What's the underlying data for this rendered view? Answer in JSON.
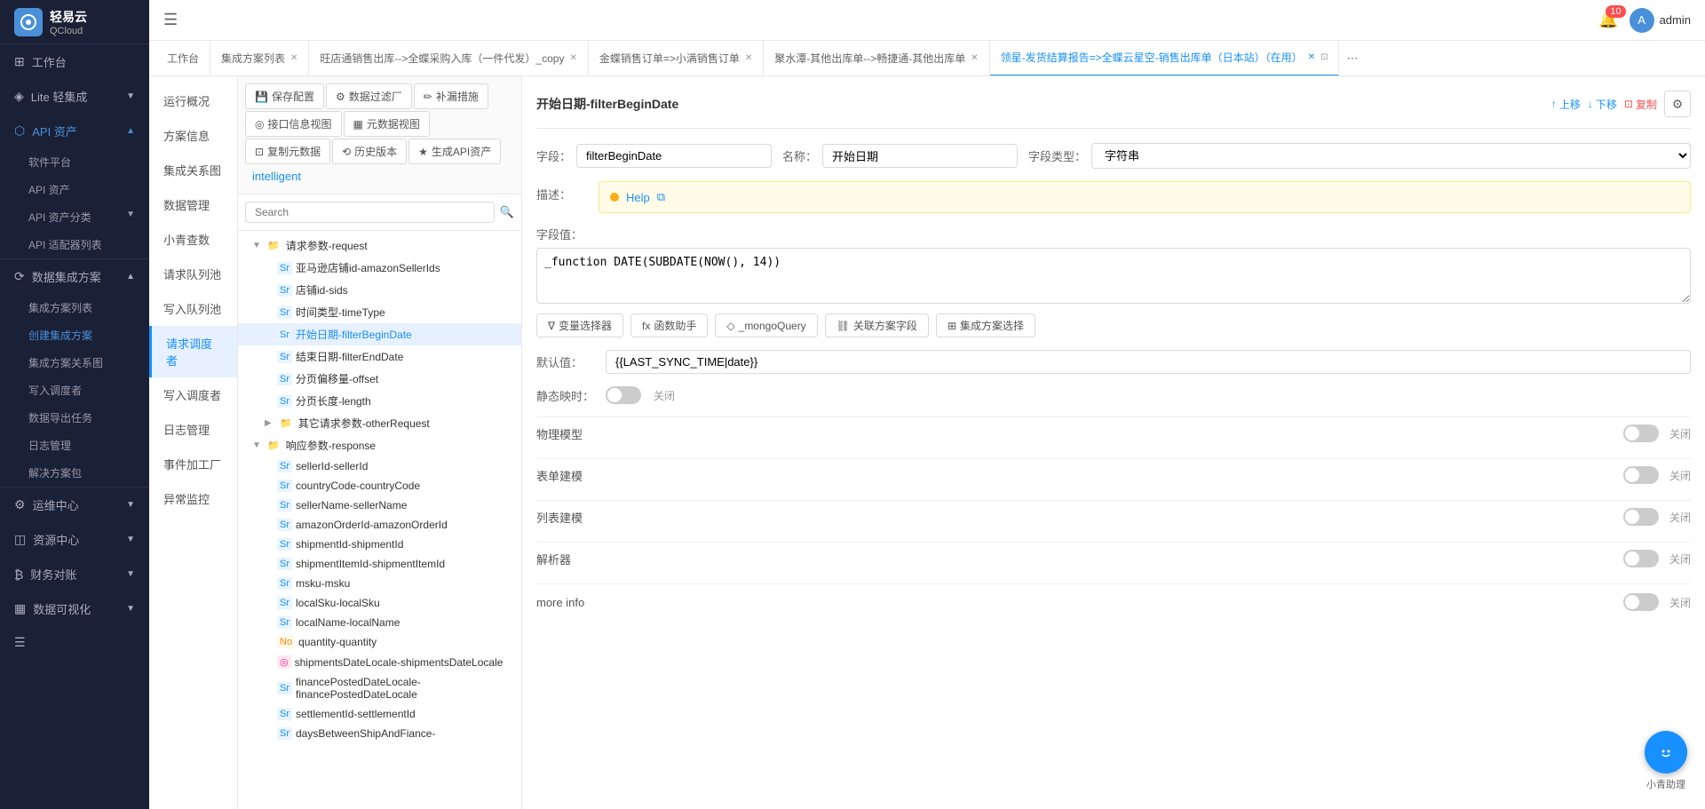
{
  "sidebar": {
    "logo_text": "轻易云",
    "logo_sub": "QCloud",
    "items": [
      {
        "id": "workspace",
        "label": "工作台",
        "icon": "⊞",
        "has_arrow": false
      },
      {
        "id": "lite",
        "label": "Lite 轻集成",
        "icon": "◈",
        "has_arrow": true
      },
      {
        "id": "api_assets",
        "label": "API 资产",
        "icon": "⬡",
        "has_arrow": true,
        "active": true,
        "expanded": true
      },
      {
        "id": "software_platform",
        "label": "软件平台",
        "sub": true
      },
      {
        "id": "api_assets_sub",
        "label": "API 资产",
        "sub": true
      },
      {
        "id": "api_category",
        "label": "API 资产分类",
        "sub": true,
        "has_arrow": true
      },
      {
        "id": "api_adapter",
        "label": "API 适配器列表",
        "sub": true
      },
      {
        "id": "data_integration",
        "label": "数据集成方案",
        "icon": "⟳",
        "has_arrow": true,
        "expanded": true
      },
      {
        "id": "integration_list",
        "label": "集成方案列表",
        "sub": true
      },
      {
        "id": "create_integration",
        "label": "创建集成方案",
        "sub": true,
        "active": true
      },
      {
        "id": "integration_rel",
        "label": "集成方案关系图",
        "sub": true
      },
      {
        "id": "write_dispatch",
        "label": "写入调度者",
        "sub": true
      },
      {
        "id": "data_export",
        "label": "数据导出任务",
        "sub": true
      },
      {
        "id": "log_mgmt",
        "label": "日志管理",
        "sub": true
      },
      {
        "id": "solution_pkg",
        "label": "解决方案包",
        "sub": true
      },
      {
        "id": "ops_center",
        "label": "运维中心",
        "icon": "⚙",
        "has_arrow": true
      },
      {
        "id": "resource_center",
        "label": "资源中心",
        "icon": "◫",
        "has_arrow": true
      },
      {
        "id": "finance",
        "label": "财务对账",
        "icon": "₿",
        "has_arrow": true
      },
      {
        "id": "data_viz",
        "label": "数据可视化",
        "icon": "▦",
        "has_arrow": true
      }
    ]
  },
  "header": {
    "notif_count": "10",
    "username": "admin"
  },
  "tabs": [
    {
      "id": "workspace",
      "label": "工作台",
      "closable": false
    },
    {
      "id": "integration_list",
      "label": "集成方案列表",
      "closable": true
    },
    {
      "id": "wangdian",
      "label": "旺店通销售出库-->全蝶采购入库（一件代发）_copy",
      "closable": true
    },
    {
      "id": "jinding",
      "label": "金蝶销售订单=>小满销售订单",
      "closable": true
    },
    {
      "id": "jushuitan",
      "label": "聚水潭-其他出库单-->畅捷通-其他出库单",
      "closable": true
    },
    {
      "id": "lingshou",
      "label": "领星-发货结算报告=>全蝶云星空-销售出库单（日本站）（在用）",
      "closable": true,
      "active": true
    }
  ],
  "left_nav": {
    "items": [
      {
        "id": "overview",
        "label": "运行概况"
      },
      {
        "id": "plan_info",
        "label": "方案信息"
      },
      {
        "id": "integration_map",
        "label": "集成关系图"
      },
      {
        "id": "data_mgmt",
        "label": "数据管理"
      },
      {
        "id": "xiao_qing",
        "label": "小青查数"
      },
      {
        "id": "request_queue",
        "label": "请求队列池"
      },
      {
        "id": "write_queue",
        "label": "写入队列池"
      },
      {
        "id": "request_dispatch",
        "label": "请求调度者",
        "active": true
      },
      {
        "id": "write_dispatch2",
        "label": "写入调度者"
      },
      {
        "id": "log_mgmt2",
        "label": "日志管理"
      },
      {
        "id": "event_factory",
        "label": "事件加工厂"
      },
      {
        "id": "anomaly_monitor",
        "label": "异常监控"
      }
    ]
  },
  "center_toolbar": {
    "buttons": [
      {
        "id": "save_config",
        "label": "保存配置",
        "icon": "💾"
      },
      {
        "id": "data_filter",
        "label": "数据过滤厂",
        "icon": "⚙"
      },
      {
        "id": "patch_measure",
        "label": "补漏措施",
        "icon": "✏"
      },
      {
        "id": "interface_view",
        "label": "接口信息视图",
        "icon": "◎"
      },
      {
        "id": "meta_view",
        "label": "元数据视图",
        "icon": "▦"
      },
      {
        "id": "copy_data",
        "label": "复制元数据",
        "icon": "⊡"
      },
      {
        "id": "history",
        "label": "历史版本",
        "icon": "⟲"
      },
      {
        "id": "gen_api",
        "label": "生成API资产",
        "icon": "★"
      },
      {
        "id": "intelligent",
        "label": "intelligent",
        "special": true
      }
    ]
  },
  "search": {
    "placeholder": "Search",
    "value": ""
  },
  "tree": {
    "nodes": [
      {
        "id": "request_params",
        "label": "请求参数-request",
        "type": "folder",
        "level": 0,
        "expanded": true
      },
      {
        "id": "amazon_seller_ids",
        "label": "亚马逊店铺id-amazonSellerIds",
        "type": "Sr",
        "level": 1
      },
      {
        "id": "store_id_sids",
        "label": "店铺id-sids",
        "type": "Sr",
        "level": 1
      },
      {
        "id": "time_type",
        "label": "时间类型-timeType",
        "type": "Sr",
        "level": 1
      },
      {
        "id": "begin_date",
        "label": "开始日期-filterBeginDate",
        "type": "Sr",
        "level": 1,
        "selected": true
      },
      {
        "id": "end_date",
        "label": "结束日期-filterEndDate",
        "type": "Sr",
        "level": 1
      },
      {
        "id": "offset",
        "label": "分页偏移量-offset",
        "type": "Sr",
        "level": 1
      },
      {
        "id": "length",
        "label": "分页长度-length",
        "type": "Sr",
        "level": 1
      },
      {
        "id": "other_request",
        "label": "其它请求参数-otherRequest",
        "type": "folder",
        "level": 1
      },
      {
        "id": "response_params",
        "label": "响应参数-response",
        "type": "folder",
        "level": 0,
        "expanded": true
      },
      {
        "id": "seller_id",
        "label": "sellerId-sellerId",
        "type": "Sr",
        "level": 1
      },
      {
        "id": "country_code",
        "label": "countryCode-countryCode",
        "type": "Sr",
        "level": 1
      },
      {
        "id": "seller_name",
        "label": "sellerName-sellerName",
        "type": "Sr",
        "level": 1
      },
      {
        "id": "amazon_order_id",
        "label": "amazonOrderId-amazonOrderId",
        "type": "Sr",
        "level": 1
      },
      {
        "id": "shipment_id",
        "label": "shipmentId-shipmentId",
        "type": "Sr",
        "level": 1
      },
      {
        "id": "shipment_item_id",
        "label": "shipmentItemId-shipmentItemId",
        "type": "Sr",
        "level": 1
      },
      {
        "id": "msku",
        "label": "msku-msku",
        "type": "Sr",
        "level": 1
      },
      {
        "id": "local_sku",
        "label": "localSku-localSku",
        "type": "Sr",
        "level": 1
      },
      {
        "id": "local_name",
        "label": "localName-localName",
        "type": "Sr",
        "level": 1
      },
      {
        "id": "quantity",
        "label": "quantity-quantity",
        "type": "No",
        "level": 1
      },
      {
        "id": "shipments_date",
        "label": "shipmentsDateLocale-shipmentsDateLocale",
        "type": "◎",
        "level": 1
      },
      {
        "id": "finance_date",
        "label": "financePostedDateLocale-financePostedDateLocale",
        "type": "Sr",
        "level": 1
      },
      {
        "id": "settlement_id",
        "label": "settlementId-settlementId",
        "type": "Sr",
        "level": 1
      },
      {
        "id": "days_between",
        "label": "daysBetweenShipAndFiance-",
        "type": "Sr",
        "level": 1
      }
    ]
  },
  "right_panel": {
    "title": "开始日期-filterBeginDate",
    "actions": {
      "up": "上移",
      "down": "下移",
      "copy": "复制"
    },
    "field_label": "字段：",
    "field_value": "filterBeginDate",
    "name_label": "名称：",
    "name_value": "开始日期",
    "type_label": "字段类型：",
    "type_value": "字符串",
    "desc_label": "描述：",
    "desc_help": "Help",
    "value_label": "字段值：",
    "value_content": "_function DATE(SUBDATE(NOW(), 14))",
    "buttons": {
      "var_selector": "变量选择器",
      "func_helper": "函数助手",
      "mongo_query": "_mongoQuery",
      "related_field": "关联方案字段",
      "integration_select": "集成方案选择"
    },
    "default_label": "默认值：",
    "default_value": "{{LAST_SYNC_TIME|date}}",
    "static_label": "静态映时：",
    "static_off": "关闭",
    "physical_model": "物理模型",
    "physical_model_off": "关闭",
    "table_build": "表单建模",
    "table_build_off": "关闭",
    "list_build": "列表建模",
    "list_build_off": "关闭",
    "parser": "解析器",
    "parser_off": "关闭",
    "more_info": "more info",
    "more_info_off": "关闭"
  },
  "floating": {
    "label": "小青助理"
  }
}
